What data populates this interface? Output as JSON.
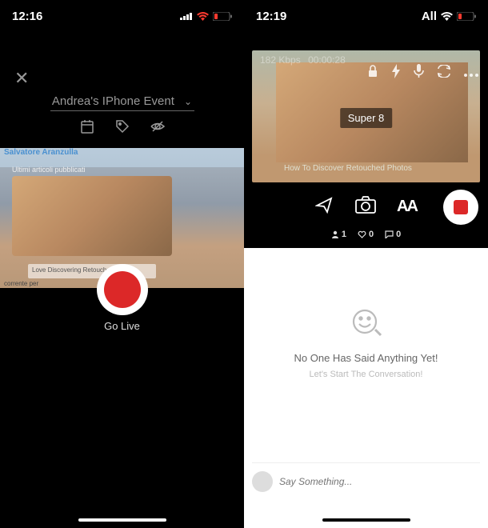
{
  "left": {
    "time": "12:16",
    "event_title": "Andrea's IPhone Event",
    "preview_brand": "Salvatore Aranzulla",
    "preview_sub": "Ultimi articoli pubblicati",
    "preview_box": "Love Discovering Retouched Photos",
    "preview_corner": "corrente per",
    "go_live_label": "Go Live"
  },
  "right": {
    "time": "12:19",
    "network_text": "All",
    "kbps": "182 Kbps",
    "elapsed": "00:00:28",
    "filter_name": "Super 8",
    "preview_caption": "How To Discover Retouched Photos",
    "text_tool": "AA",
    "stats": {
      "viewers": "1",
      "likes": "0",
      "comments": "0"
    },
    "chat": {
      "empty_title": "No One Has Said Anything Yet!",
      "empty_sub": "Let's Start The Conversation!",
      "placeholder": "Say Something..."
    }
  },
  "icons": {
    "close": "✕",
    "chevron_down": "⌄",
    "calendar": "calendar",
    "tag": "tag",
    "eye_off": "eye-off",
    "lock": "lock",
    "flash": "flash",
    "mic": "mic",
    "refresh": "refresh",
    "more": "more",
    "share": "share",
    "camera": "camera",
    "viewers": "viewers",
    "heart": "heart",
    "comment": "comment",
    "smiley": "smiley"
  }
}
